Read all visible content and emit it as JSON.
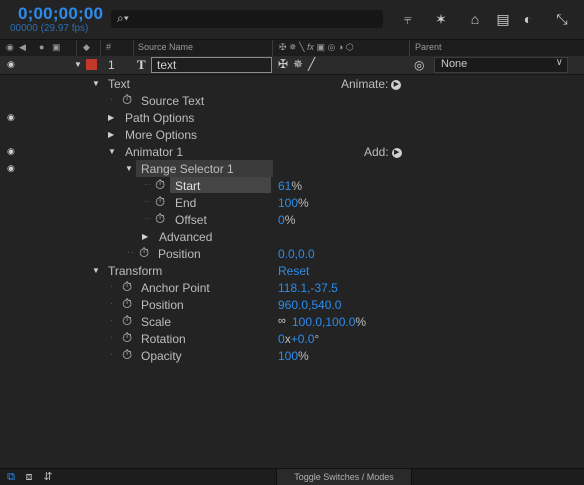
{
  "header": {
    "timecode": "0;00;00;00",
    "frame_fps": "00000 (29.97 fps)",
    "search_icon": "search-icon"
  },
  "columns": {
    "source_name": "Source Name",
    "number": "#",
    "parent": "Parent"
  },
  "layer": {
    "number": "1",
    "type_glyph": "T",
    "name": "text",
    "label_color": "#c0392b",
    "parent_value": "None"
  },
  "properties": {
    "text": "Text",
    "animate": "Animate:",
    "source_text": "Source Text",
    "path_options": "Path Options",
    "more_options": "More Options",
    "animator": "Animator 1",
    "add": "Add:",
    "range_selector": "Range Selector 1",
    "start": {
      "label": "Start",
      "value": "61",
      "unit": "%"
    },
    "end": {
      "label": "End",
      "value": "100",
      "unit": "%"
    },
    "offset": {
      "label": "Offset",
      "value": "0",
      "unit": "%"
    },
    "advanced": "Advanced",
    "anim_position": {
      "label": "Position",
      "value": "0.0,0.0"
    },
    "transform": "Transform",
    "reset": "Reset",
    "anchor_point": {
      "label": "Anchor Point",
      "value": "118.1,-37.5"
    },
    "position": {
      "label": "Position",
      "value": "960.0,540.0"
    },
    "scale": {
      "label": "Scale",
      "value": "100.0,100.0",
      "unit": "%"
    },
    "rotation": {
      "label": "Rotation",
      "value_rev": "0",
      "x": "x",
      "value_deg": "+0.0",
      "unit": "°"
    },
    "opacity": {
      "label": "Opacity",
      "value": "100",
      "unit": "%"
    }
  },
  "footer": {
    "toggle_label": "Toggle Switches / Modes"
  },
  "colors": {
    "accent": "#2d8ceb",
    "background": "#232323"
  }
}
